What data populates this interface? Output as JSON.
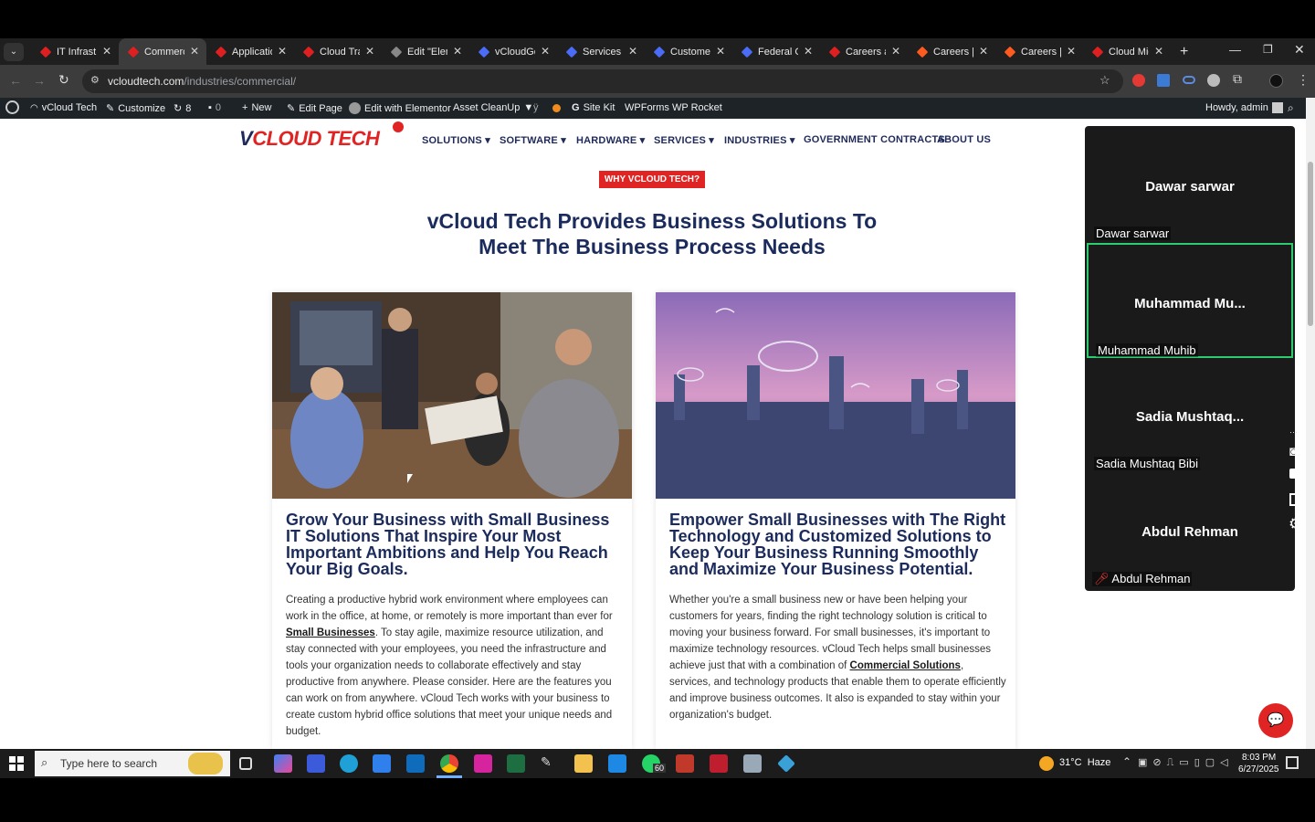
{
  "browser": {
    "tabs": [
      {
        "label": "IT Infrastru",
        "color": "#e02020"
      },
      {
        "label": "Commerci",
        "color": "#e02020",
        "active": true
      },
      {
        "label": "Applicatio",
        "color": "#e02020"
      },
      {
        "label": "Cloud Tran",
        "color": "#e02020"
      },
      {
        "label": "Edit \"Eleme",
        "color": "#888888"
      },
      {
        "label": "vCloudGo",
        "color": "#4a6cf7"
      },
      {
        "label": "Services -",
        "color": "#4a6cf7"
      },
      {
        "label": "Customer",
        "color": "#4a6cf7"
      },
      {
        "label": "Federal Go",
        "color": "#4a6cf7"
      },
      {
        "label": "Careers at",
        "color": "#e02020"
      },
      {
        "label": "Careers | A",
        "color": "#ff5a1f"
      },
      {
        "label": "Careers | A",
        "color": "#ff5a1f"
      },
      {
        "label": "Cloud Mig",
        "color": "#e02020"
      }
    ],
    "url_host": "vcloudtech.com",
    "url_path": "/industries/commercial/"
  },
  "wp_admin": {
    "site": "vCloud Tech",
    "customize": "Customize",
    "updates": "8",
    "comments": "0",
    "new": "New",
    "edit_page": "Edit Page",
    "edit_elementor": "Edit with Elementor",
    "asset_cleanup": "Asset CleanUp",
    "site_kit": "Site Kit",
    "wpforms": "WPForms",
    "wp_rocket": "WP Rocket",
    "howdy": "Howdy, admin"
  },
  "site": {
    "logo_v": "V",
    "logo_rest": "CLOUD TECH",
    "nav": [
      "SOLUTIONS",
      "SOFTWARE",
      "HARDWARE",
      "SERVICES",
      "INDUSTRIES",
      "GOVERNMENT CONTRACTS",
      "ABOUT US"
    ],
    "badge": "WHY VCLOUD TECH?",
    "heading_line1": "vCloud Tech Provides Business Solutions To",
    "heading_line2": "Meet The Business Process Needs",
    "card1": {
      "title": "Grow Your Business with Small Business IT Solutions That Inspire Your Most Important Ambitions and Help You Reach Your Big Goals.",
      "text_before": "Creating a productive hybrid work environment where employees can work in the office, at home, or remotely is more important than ever for ",
      "link": "Small Businesses",
      "text_after": ". To stay agile, maximize resource utilization, and stay connected with your employees, you need the infrastructure and tools your organization needs to collaborate effectively and stay productive from anywhere. Please consider. Here are the features you can work on from anywhere. vCloud Tech works with your business to create custom hybrid office solutions that meet your unique needs and budget."
    },
    "card2": {
      "title": "Empower Small Businesses with The Right Technology and Customized Solutions to Keep Your Business Running Smoothly and Maximize Your Business Potential.",
      "text_before": "Whether you're a small business new or have been helping your customers for years, finding the right technology solution is critical to moving your business forward. For small businesses, it's important to maximize technology resources. vCloud Tech helps small businesses achieve just that with a combination of ",
      "link": "Commercial Solutions",
      "text_after": ", services, and technology products that enable them to operate efficiently and improve business outcomes. It also is expanded to stay within your organization's budget."
    }
  },
  "meeting": {
    "participants": [
      {
        "big": "Dawar sarwar",
        "small": "Dawar sarwar"
      },
      {
        "big": "Muhammad  Mu...",
        "small": "Muhammad Muhib",
        "active": true
      },
      {
        "big": "Sadia  Mushtaq...",
        "small": "Sadia Mushtaq Bibi"
      },
      {
        "big": "Abdul Rehman",
        "small": "Abdul Rehman",
        "muted": true
      }
    ]
  },
  "taskbar": {
    "search_placeholder": "Type here to search",
    "weather": "31°C  Haze",
    "time": "8:03 PM",
    "date": "6/27/2025",
    "whatsapp_badge": "60"
  }
}
